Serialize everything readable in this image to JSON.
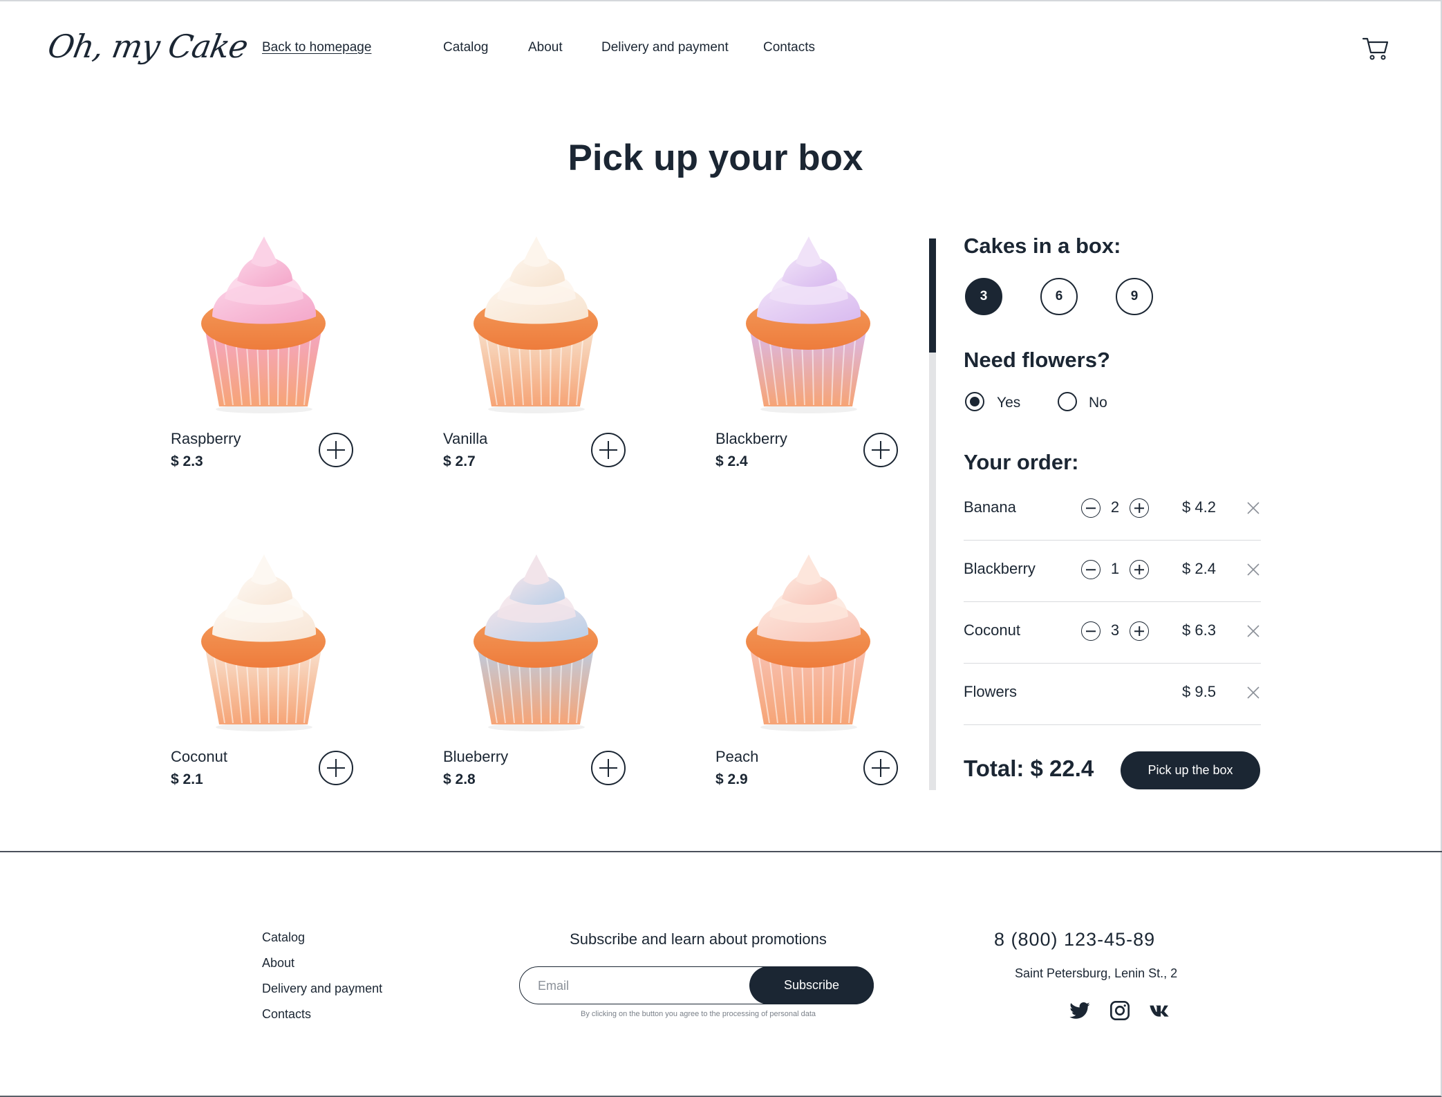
{
  "header": {
    "logo": "Oh, my Cake",
    "nav": {
      "back": "Back to homepage",
      "catalog": "Catalog",
      "about": "About",
      "delivery": "Delivery and payment",
      "contacts": "Contacts"
    },
    "cart_icon": "cart-icon"
  },
  "page_title": "Pick up your box",
  "products": [
    {
      "name": "Raspberry",
      "price": "$ 2.3",
      "frosting": "#f4a6c9",
      "frosting2": "#fbd2e6"
    },
    {
      "name": "Vanilla",
      "price": "$ 2.7",
      "frosting": "#f7e3cf",
      "frosting2": "#fdf5ec"
    },
    {
      "name": "Blackberry",
      "price": "$ 2.4",
      "frosting": "#d8b9ef",
      "frosting2": "#f0e2f8"
    },
    {
      "name": "Coconut",
      "price": "$ 2.1",
      "frosting": "#f8e6d6",
      "frosting2": "#fdf8f2"
    },
    {
      "name": "Blueberry",
      "price": "$ 2.8",
      "frosting": "#b9cfe8",
      "frosting2": "#f2e4ea"
    },
    {
      "name": "Peach",
      "price": "$ 2.9",
      "frosting": "#f8c4b8",
      "frosting2": "#fde6dc"
    }
  ],
  "panel": {
    "cakes_title": "Cakes in a box:",
    "sizes": [
      "3",
      "6",
      "9"
    ],
    "selected_size": "3",
    "flowers_title": "Need flowers?",
    "flowers_yes": "Yes",
    "flowers_no": "No",
    "flowers_selected": "Yes",
    "order_title": "Your order:",
    "order": [
      {
        "name": "Banana",
        "qty": "2",
        "price": "$ 4.2"
      },
      {
        "name": "Blackberry",
        "qty": "1",
        "price": "$ 2.4"
      },
      {
        "name": "Coconut",
        "qty": "3",
        "price": "$ 6.3"
      },
      {
        "name": "Flowers",
        "qty": "",
        "price": "$ 9.5"
      }
    ],
    "total": "Total: $ 22.4",
    "pick_button": "Pick up the box"
  },
  "footer": {
    "links": [
      "Catalog",
      "About",
      "Delivery and payment",
      "Contacts"
    ],
    "subscribe_title": "Subscribe and learn about promotions",
    "email_placeholder": "Email",
    "subscribe_button": "Subscribe",
    "disclaimer": "By clicking on the button you agree to the processing of personal data",
    "phone": "8 (800) 123-45-89",
    "address": "Saint Petersburg, Lenin St., 2",
    "social_icons": [
      "twitter-icon",
      "instagram-icon",
      "vk-icon"
    ]
  },
  "colors": {
    "dark": "#1b2633",
    "cake_base": "#f08a4b",
    "liner": "#f3a27a",
    "divider": "#d8dadd"
  }
}
